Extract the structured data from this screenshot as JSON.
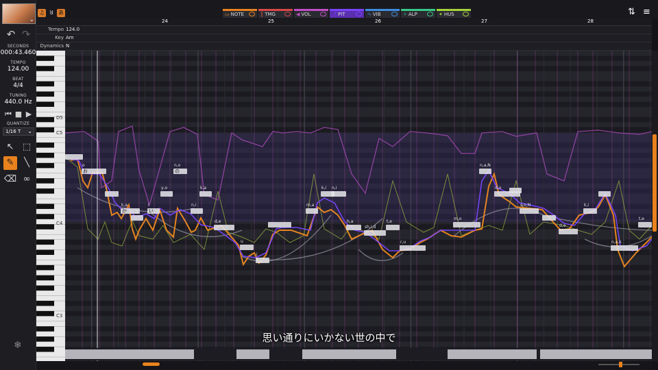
{
  "voice": {
    "name": "Voice avatar"
  },
  "left_panel": {
    "seconds_label": "SECONDS",
    "seconds_value": "000:43.460",
    "tempo_label": "TEMPO",
    "tempo_value": "124.00",
    "beat_label": "BEAT",
    "beat_value": "4/4",
    "tuning_label": "TUNING",
    "tuning_value": "440.0 Hz",
    "quantize_label": "QUANTIZE",
    "quantize_value": "1/16 T"
  },
  "tabs": [
    {
      "label": "NOTE",
      "color": "#e9821d",
      "icon": "note-icon"
    },
    {
      "label": "TMG",
      "color": "#d94848",
      "icon": "timing-icon"
    },
    {
      "label": "VOL",
      "color": "#c24ec8",
      "icon": "volume-icon"
    },
    {
      "label": "PIT",
      "color": "#7b44ff",
      "icon": "pitch-icon"
    },
    {
      "label": "VIB",
      "color": "#3e8de0",
      "icon": "vibrato-icon"
    },
    {
      "label": "ALP",
      "color": "#38c98a",
      "icon": "alpha-icon"
    },
    {
      "label": "HUS",
      "color": "#a6d43a",
      "icon": "husky-icon"
    }
  ],
  "ruler": {
    "bars": [
      "24",
      "25",
      "26",
      "27",
      "28"
    ]
  },
  "params": {
    "tempo_label": "Tempo",
    "tempo_value": "124.0",
    "key_label": "Key",
    "key_value": "Am",
    "dynamics_label": "Dynamics",
    "dynamics_value": "N"
  },
  "piano_labels": [
    "D5",
    "C5",
    "C4",
    "C3"
  ],
  "notes": [
    {
      "phoneme": "",
      "lyric": ""
    },
    {
      "phoneme": "o",
      "lyric": "お"
    },
    {
      "phoneme": "i",
      "lyric": ""
    },
    {
      "phoneme": "k,a",
      "lyric": "か"
    },
    {
      "phoneme": "n,a",
      "lyric": ""
    },
    {
      "phoneme": "i",
      "lyric": "い"
    },
    {
      "phoneme": "y,o",
      "lyric": ""
    },
    {
      "phoneme": "n,o",
      "lyric": "の"
    },
    {
      "phoneme": "n,i",
      "lyric": ""
    },
    {
      "phoneme": "k,a",
      "lyric": ""
    },
    {
      "phoneme": "d,e",
      "lyric": ""
    },
    {
      "phoneme": "u",
      "lyric": ""
    },
    {
      "phoneme": "i",
      "lyric": ""
    },
    {
      "phoneme": "m,a",
      "lyric": ""
    },
    {
      "phoneme": "k,i",
      "lyric": ""
    },
    {
      "phoneme": "n,i",
      "lyric": ""
    },
    {
      "phoneme": "h,a",
      "lyric": ""
    },
    {
      "phoneme": "sh,i,d",
      "lyric": ""
    },
    {
      "phoneme": "t,e",
      "lyric": ""
    },
    {
      "phoneme": "r,u",
      "lyric": ""
    },
    {
      "phoneme": "m,o",
      "lyric": ""
    },
    {
      "phoneme": "n,a,N",
      "lyric": ""
    },
    {
      "phoneme": "d,o",
      "lyric": ""
    },
    {
      "phoneme": "s,o,N",
      "lyric": ""
    },
    {
      "phoneme": "d,e",
      "lyric": ""
    },
    {
      "phoneme": "k,i",
      "lyric": ""
    },
    {
      "phoneme": "t,e",
      "lyric": ""
    },
    {
      "phoneme": "n,a,k",
      "lyric": ""
    }
  ],
  "subtitle": "思い通りにいかない世の中で",
  "colors": {
    "accent": "#e9821d",
    "pitch_purple": "#7b44ff",
    "volume_magenta": "#c24ec8",
    "husky_green": "#a6d43a"
  }
}
